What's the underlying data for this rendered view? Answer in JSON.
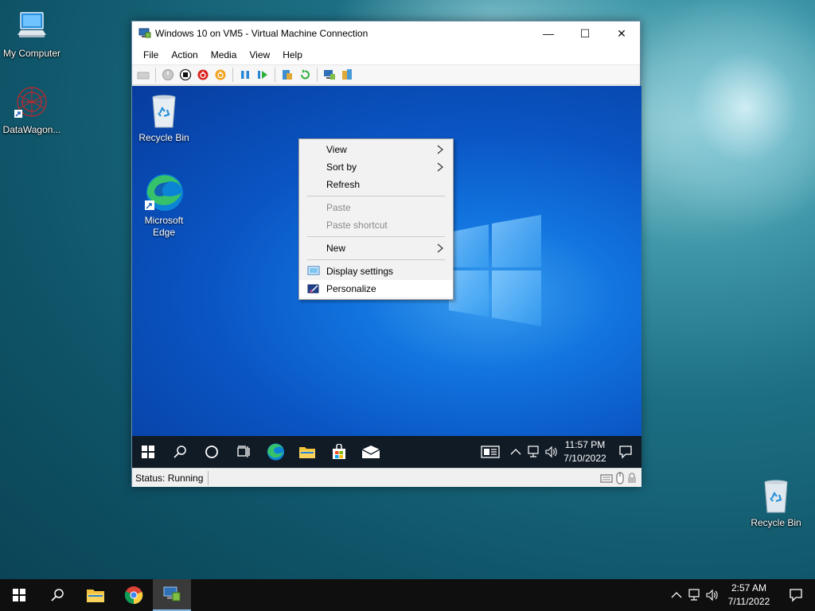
{
  "host_desktop": {
    "icons": [
      {
        "label": "My Computer"
      },
      {
        "label": "DataWagon..."
      },
      {
        "label": "Recycle Bin"
      }
    ]
  },
  "vm_window": {
    "title": "Windows 10 on VM5 - Virtual Machine Connection",
    "controls": {
      "minimize": "—",
      "maximize": "☐",
      "close": "✕"
    },
    "menu": [
      "File",
      "Action",
      "Media",
      "View",
      "Help"
    ],
    "status": "Status: Running"
  },
  "guest": {
    "desktop_icons": [
      {
        "label": "Recycle Bin"
      },
      {
        "label": "Microsoft Edge"
      }
    ],
    "context_menu": {
      "items": [
        {
          "label": "View",
          "submenu": true,
          "disabled": false
        },
        {
          "label": "Sort by",
          "submenu": true,
          "disabled": false
        },
        {
          "label": "Refresh",
          "submenu": false,
          "disabled": false
        },
        {
          "label": "Paste",
          "submenu": false,
          "disabled": true
        },
        {
          "label": "Paste shortcut",
          "submenu": false,
          "disabled": true
        },
        {
          "label": "New",
          "submenu": true,
          "disabled": false
        },
        {
          "label": "Display settings",
          "icon": "display-icon",
          "disabled": false
        },
        {
          "label": "Personalize",
          "icon": "personalize-icon",
          "disabled": false,
          "highlighted": true
        }
      ]
    },
    "taskbar": {
      "time": "11:57 PM",
      "date": "7/10/2022"
    }
  },
  "host_taskbar": {
    "time": "2:57 AM",
    "date": "7/11/2022"
  },
  "colors": {
    "guest_desktop": "#0a55c4",
    "taskbar": "#0f0f0f",
    "menu_background": "#f2f2f2"
  }
}
